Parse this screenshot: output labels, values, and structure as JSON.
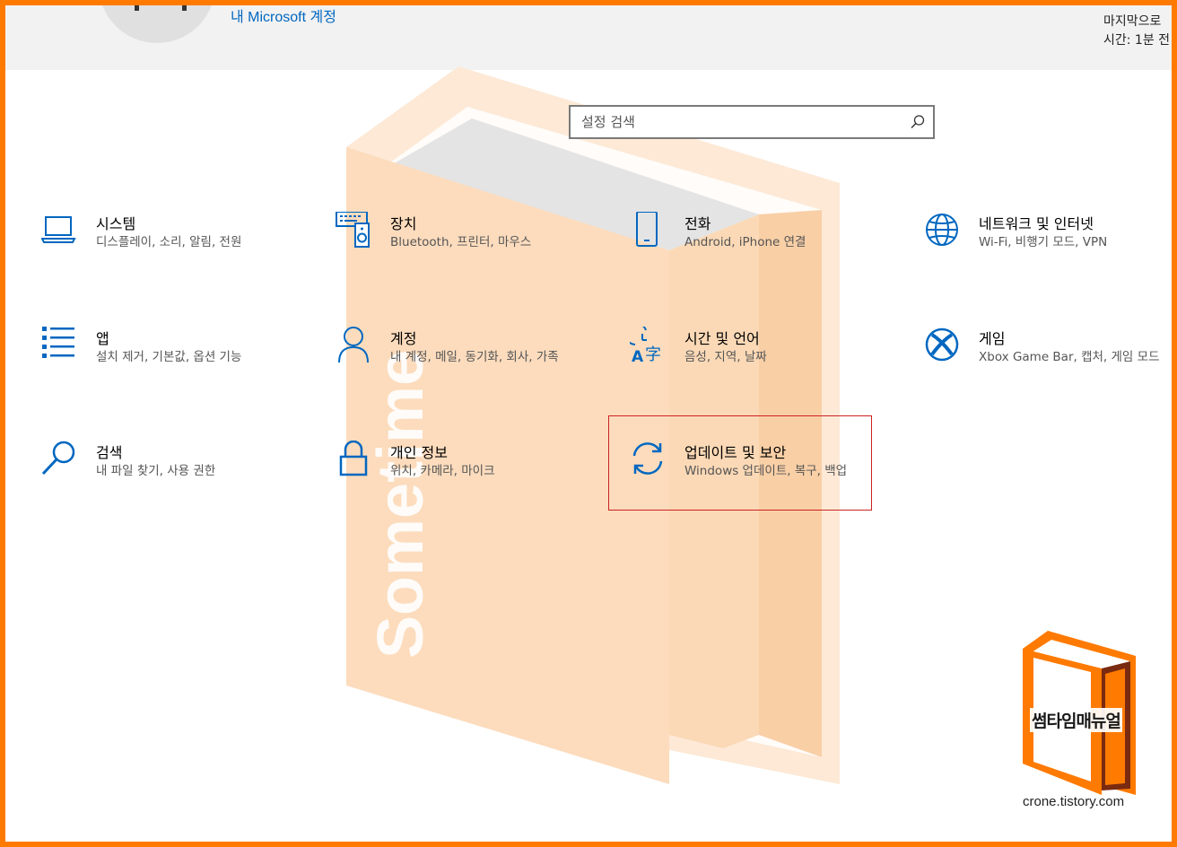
{
  "header": {
    "account_link": "내 Microsoft 계정",
    "sync_line1": "마지막으로",
    "sync_line2": "시간: 1분 전"
  },
  "search": {
    "placeholder": "설정 검색"
  },
  "tiles": [
    {
      "title": "시스템",
      "desc": "디스플레이, 소리, 알림, 전원",
      "icon": "laptop-icon"
    },
    {
      "title": "장치",
      "desc": "Bluetooth, 프린터, 마우스",
      "icon": "devices-icon"
    },
    {
      "title": "전화",
      "desc": "Android, iPhone 연결",
      "icon": "phone-icon"
    },
    {
      "title": "네트워크 및 인터넷",
      "desc": "Wi-Fi, 비행기 모드, VPN",
      "icon": "globe-icon"
    },
    {
      "title": "앱",
      "desc": "설치 제거, 기본값, 옵션 기능",
      "icon": "apps-list-icon"
    },
    {
      "title": "계정",
      "desc": "내 계정, 메일, 동기화, 회사, 가족",
      "icon": "person-icon"
    },
    {
      "title": "시간 및 언어",
      "desc": "음성, 지역, 날짜",
      "icon": "time-language-icon"
    },
    {
      "title": "게임",
      "desc": "Xbox Game Bar, 캡처, 게임 모드",
      "icon": "xbox-icon"
    },
    {
      "title": "검색",
      "desc": "내 파일 찾기, 사용 권한",
      "icon": "search-icon"
    },
    {
      "title": "개인 정보",
      "desc": "위치, 카메라, 마이크",
      "icon": "lock-icon"
    },
    {
      "title": "업데이트 및 보안",
      "desc": "Windows 업데이트, 복구, 백업",
      "icon": "sync-icon"
    }
  ],
  "watermark": {
    "vertical_text": "Sometime",
    "logo_title": "썸타임매뉴얼",
    "logo_url": "crone.tistory.com"
  },
  "colors": {
    "accent": "#0067c0",
    "frame": "#ff7a00",
    "highlight": "#cc2222"
  }
}
